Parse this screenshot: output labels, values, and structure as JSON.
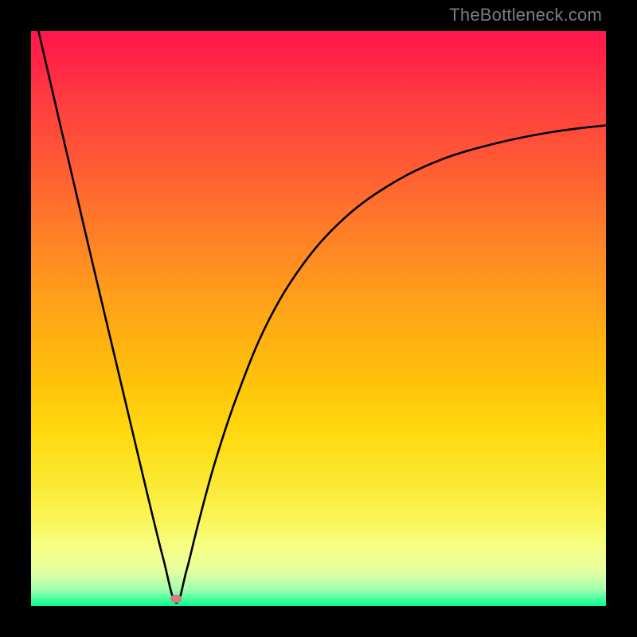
{
  "watermark_text": "TheBottleneck.com",
  "colors": {
    "frame_background": "#000000",
    "gradient_top": "#ff174e",
    "gradient_bottom": "#00ff8b",
    "curve_stroke": "#000000",
    "dot_fill": "#d67b8a"
  },
  "chart_data": {
    "type": "line",
    "title": "",
    "xlabel": "",
    "ylabel": "",
    "xlim": [
      0,
      100
    ],
    "ylim": [
      0,
      100
    ],
    "notes": "V-shaped bottleneck curve. Left branch descends nearly linearly from top-left to a minimum near x≈25, y≈0. Right branch is concave, rising steeply then tapering toward ~82% at the right edge.",
    "minimum_marker": {
      "x": 25.2,
      "y": 1.2
    },
    "series": [
      {
        "name": "bottleneck-curve",
        "points": [
          {
            "x": 1.3,
            "y": 100.0
          },
          {
            "x": 5.0,
            "y": 84.0
          },
          {
            "x": 10.0,
            "y": 62.6
          },
          {
            "x": 15.0,
            "y": 41.5
          },
          {
            "x": 20.0,
            "y": 20.4
          },
          {
            "x": 23.0,
            "y": 8.2
          },
          {
            "x": 25.2,
            "y": 0.6
          },
          {
            "x": 27.0,
            "y": 6.0
          },
          {
            "x": 29.0,
            "y": 14.0
          },
          {
            "x": 32.0,
            "y": 25.0
          },
          {
            "x": 36.0,
            "y": 37.0
          },
          {
            "x": 41.0,
            "y": 49.0
          },
          {
            "x": 47.0,
            "y": 59.0
          },
          {
            "x": 54.0,
            "y": 67.0
          },
          {
            "x": 62.0,
            "y": 73.0
          },
          {
            "x": 71.0,
            "y": 77.5
          },
          {
            "x": 81.0,
            "y": 80.5
          },
          {
            "x": 91.0,
            "y": 82.5
          },
          {
            "x": 100.0,
            "y": 83.6
          }
        ]
      }
    ]
  }
}
